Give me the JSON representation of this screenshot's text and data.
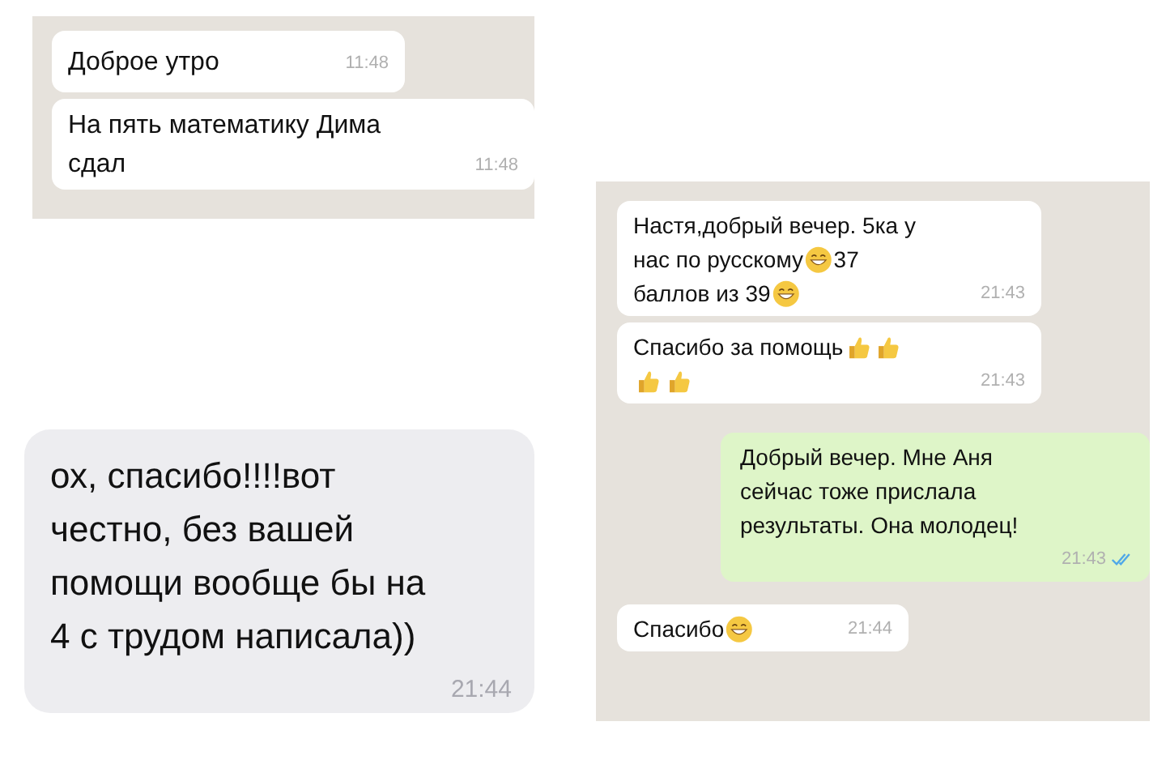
{
  "screenshots": [
    {
      "kind": "chat",
      "messages": [
        {
          "outgoing": false,
          "time": "11:48",
          "lines": [
            [
              {
                "kind": "text",
                "text": "Доброе утро"
              }
            ]
          ]
        },
        {
          "outgoing": false,
          "time": "11:48",
          "lines": [
            [
              {
                "kind": "text",
                "text": "На пять математику Дима"
              }
            ],
            [
              {
                "kind": "text",
                "text": "сдал"
              }
            ]
          ]
        }
      ]
    },
    {
      "kind": "chat",
      "messages": [
        {
          "outgoing": false,
          "time": "21:43",
          "lines": [
            [
              {
                "kind": "text",
                "text": "Настя,добрый вечер. 5ка у"
              }
            ],
            [
              {
                "kind": "text",
                "text": "нас по русскому"
              },
              {
                "kind": "grin"
              },
              {
                "kind": "text",
                "text": " 37"
              }
            ],
            [
              {
                "kind": "text",
                "text": "баллов из 39"
              },
              {
                "kind": "grin"
              }
            ]
          ]
        },
        {
          "outgoing": false,
          "time": "21:43",
          "lines": [
            [
              {
                "kind": "text",
                "text": "Спасибо за помощь"
              },
              {
                "kind": "thumb"
              },
              {
                "kind": "thumb"
              }
            ],
            [
              {
                "kind": "thumb"
              },
              {
                "kind": "thumb"
              }
            ]
          ]
        },
        {
          "outgoing": true,
          "read": true,
          "time": "21:43",
          "lines": [
            [
              {
                "kind": "text",
                "text": "Добрый вечер. Мне Аня"
              }
            ],
            [
              {
                "kind": "text",
                "text": "сейчас тоже прислала"
              }
            ],
            [
              {
                "kind": "text",
                "text": "результаты. Она молодец!"
              }
            ]
          ],
          "time_own_line": true
        },
        {
          "outgoing": false,
          "time": "21:44",
          "lines": [
            [
              {
                "kind": "text",
                "text": "Спасибо"
              },
              {
                "kind": "grin"
              }
            ]
          ]
        }
      ]
    },
    {
      "kind": "sms",
      "messages": [
        {
          "outgoing": false,
          "time": "21:44",
          "lines": [
            [
              {
                "kind": "text",
                "text": "ох, спасибо!!!!вот"
              }
            ],
            [
              {
                "kind": "text",
                "text": "честно, без вашей"
              }
            ],
            [
              {
                "kind": "text",
                "text": "помощи вообще бы на"
              }
            ],
            [
              {
                "kind": "text",
                "text": "4 с трудом написала))"
              }
            ]
          ],
          "time_own_line": true
        }
      ]
    }
  ]
}
